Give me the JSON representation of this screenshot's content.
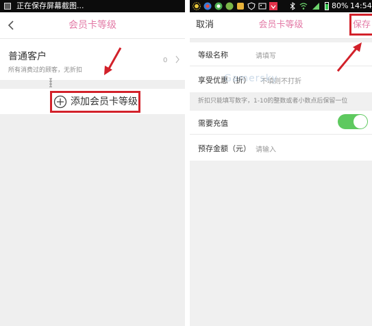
{
  "left": {
    "status_text": "正在保存屏幕截图...",
    "title": "会员卡等级",
    "level_name": "普通客户",
    "level_desc": "所有消费过的顾客，无折扣",
    "level_count": "0",
    "add_label": "添加会员卡等级"
  },
  "right": {
    "status_battery": "80%",
    "status_time": "14:54",
    "cancel_label": "取消",
    "title": "会员卡等级",
    "save_label": "保存",
    "field_name_label": "等级名称",
    "field_name_placeholder": "请填写",
    "field_discount_label": "享受优惠（折）",
    "field_discount_placeholder": "不填则不打折",
    "discount_hint": "折扣只能填写数字，1-10的整数或者小数点后保留一位",
    "recharge_label": "需要充值",
    "prestore_label": "预存金额（元）",
    "prestore_placeholder": "请输入",
    "watermark_text": "Gamersky"
  },
  "colors": {
    "accent_pink": "#e37aa6",
    "highlight_red": "#d2212a",
    "toggle_green": "#5ec95f"
  }
}
